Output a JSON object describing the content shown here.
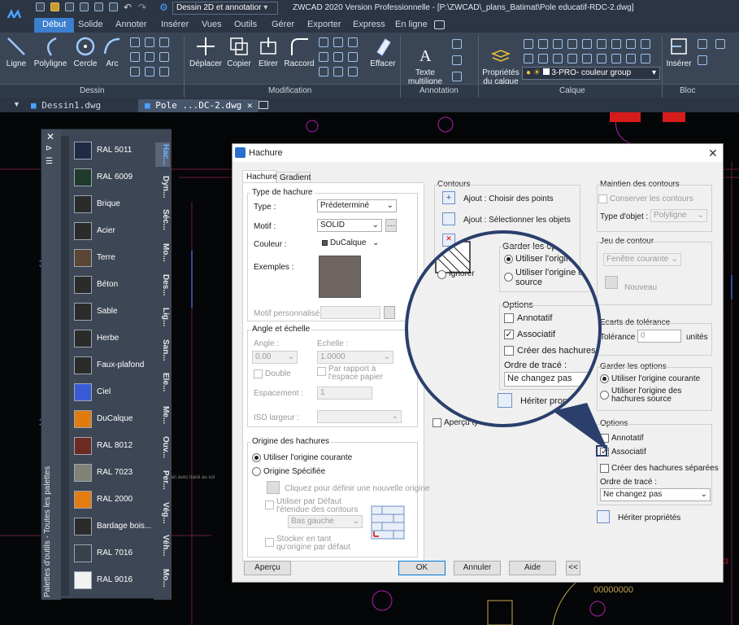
{
  "titlebar": {
    "workspace": "Dessin 2D et annotatior",
    "title": "ZWCAD 2020 Version Professionnelle - [P:\\ZWCAD\\_plans_Batimat\\Pole educatif-RDC-2.dwg]"
  },
  "ribbon_tabs": [
    "Début",
    "Solide",
    "Annoter",
    "Insérer",
    "Vues",
    "Outils",
    "Gérer",
    "Exporter",
    "Express",
    "En ligne"
  ],
  "ribbon": {
    "dessin": [
      "Ligne",
      "Polyligne",
      "Cercle",
      "Arc"
    ],
    "modification": [
      "Déplacer",
      "Copier",
      "Etirer",
      "Raccord",
      "Effacer"
    ],
    "annotation": [
      "Texte\nmultiligne"
    ],
    "calque_label": "Propriétés\ndu calque",
    "layer": "3-PRO- couleur group",
    "bloc": [
      "Insérer"
    ],
    "panels": [
      "Dessin",
      "Modification",
      "Annotation",
      "Calque",
      "Bloc"
    ]
  },
  "doc_tabs": [
    "Dessin1.dwg",
    "Pole ...DC-2.dwg"
  ],
  "palette": {
    "title": "Palettes d'outils - Toutes les palettes",
    "items": [
      {
        "label": "RAL 5011",
        "color": "#1f2a44"
      },
      {
        "label": "RAL 6009",
        "color": "#1e3b2c"
      },
      {
        "label": "Brique",
        "color": "#2b2b2b"
      },
      {
        "label": "Acier",
        "color": "#2b2b2b"
      },
      {
        "label": "Terre",
        "color": "#5a4632"
      },
      {
        "label": "Béton",
        "color": "#2b2b2b"
      },
      {
        "label": "Sable",
        "color": "#2b2b2b"
      },
      {
        "label": "Herbe",
        "color": "#2b2b2b"
      },
      {
        "label": "Faux-plafond",
        "color": "#2b2b2b"
      },
      {
        "label": "Ciel",
        "color": "#3b5bd6"
      },
      {
        "label": "DuCalque",
        "color": "#e07b10"
      },
      {
        "label": "RAL 8012",
        "color": "#6b2b22"
      },
      {
        "label": "RAL 7023",
        "color": "#808276"
      },
      {
        "label": "RAL 2000",
        "color": "#e57c12"
      },
      {
        "label": "Bardage bois...",
        "color": "#2b2b2b"
      },
      {
        "label": "RAL 7016",
        "color": "#38404a"
      },
      {
        "label": "RAL 9016",
        "color": "#f2f2f2"
      }
    ],
    "tabs": [
      "Hac...",
      "Dyn...",
      "Séc...",
      "Mo...",
      "Des...",
      "Lig...",
      "San...",
      "Ele...",
      "Me...",
      "Ouv...",
      "Per...",
      "Vég...",
      "Véh...",
      "Mo..."
    ]
  },
  "dialog": {
    "title": "Hachure",
    "tabs": [
      "Hachure",
      "Gradient"
    ],
    "type": {
      "group": "Type de hachure",
      "type_label": "Type :",
      "type_value": "Prédeterminé",
      "motif_label": "Motif :",
      "motif_value": "SOLID",
      "couleur_label": "Couleur :",
      "couleur_value": "DuCalque",
      "exemples_label": "Exemples :",
      "motif_perso_label": "Motif personnalisé :"
    },
    "angle": {
      "group": "Angle et échelle",
      "angle_label": "Angle :",
      "angle_value": "0.00",
      "echelle_label": "Echelle :",
      "echelle_value": "1.0000",
      "double_label": "Double",
      "rapport_label": "Par rapport à l'espace papier",
      "espacement_label": "Espacement :",
      "espacement_value": "1",
      "isd_label": "ISD largeur :"
    },
    "origine": {
      "group": "Origine des hachures",
      "courante": "Utiliser l'origine courante",
      "specifiee": "Origine Spécifiée",
      "cliquez": "Cliquez pour définir une nouvelle origine",
      "defaut": "Utiliser par Défaut l'étendue des contours",
      "bas_gauche": "Bas gauche",
      "stocker": "Stocker en tant qu'origine par défaut"
    },
    "contours": {
      "group": "Contours",
      "ajout_points": "Ajout : Choisir des points",
      "ajout_objets": "Ajout : Sélectionner les objets",
      "ignorer": "Ignorer",
      "apercu_label": "Aperçu ty"
    },
    "maintien": {
      "group": "Maintien des contours",
      "conserver": "Conserver les contours",
      "type_objet_label": "Type d'objet :",
      "type_objet_value": "Polyligne"
    },
    "jeu": {
      "group": "Jeu de contour",
      "fenetre": "Fenêtre courante",
      "nouveau": "Nouveau"
    },
    "ecarts": {
      "group": "Ecarts de tolérance",
      "tolerance_label": "Tolérance",
      "tolerance_value": "0",
      "unites": "unités"
    },
    "garder": {
      "group": "Garder les options",
      "courante": "Utiliser l'origine courante",
      "source": "Utiliser l'origine des hachures source"
    },
    "options": {
      "group": "Options",
      "annotatif": "Annotatif",
      "associatif": "Associatif",
      "separees": "Créer des hachures séparées",
      "ordre_label": "Ordre de tracé :",
      "ordre_value": "Ne changez pas",
      "heriter": "Hériter propriétés"
    },
    "buttons": {
      "apercu": "Aperçu",
      "ok": "OK",
      "annuler": "Annuler",
      "aide": "Aide",
      "more": "<<"
    }
  },
  "magnifier": {
    "garder": "Garder les optio",
    "courante": "Utiliser l'origine cou",
    "source_1": "Utiliser l'origine des ha",
    "source_2": "source",
    "options": "Options",
    "annotatif": "Annotatif",
    "associatif": "Associatif",
    "separees": "Créer des hachures séparée",
    "ordre_label": "Ordre de tracé :",
    "ordre_value": "Ne changez pas",
    "heriter": "Hériter propriétés",
    "ignorer": "Ignorer"
  },
  "drawing": {
    "note": "Plan avec tracé au sol"
  }
}
